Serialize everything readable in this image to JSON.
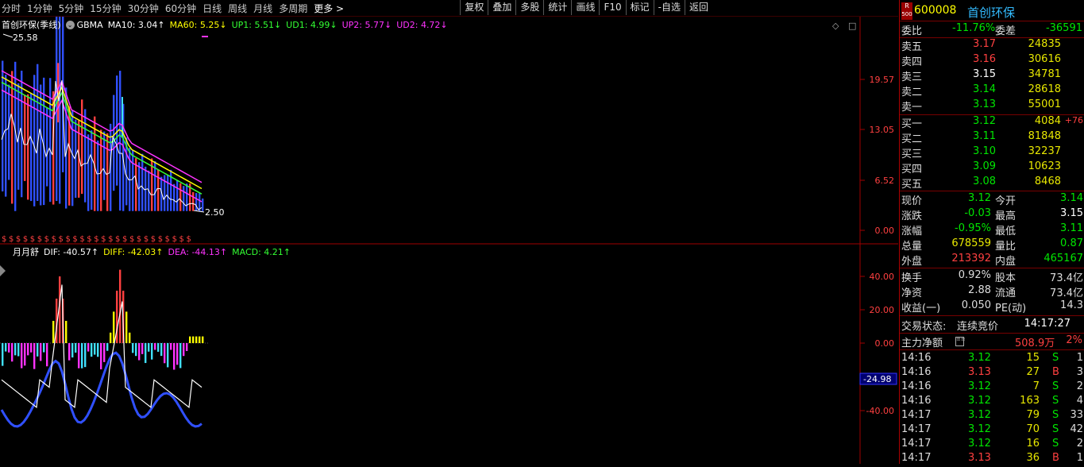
{
  "toolbar": {
    "periods": [
      "分时",
      "1分钟",
      "5分钟",
      "15分钟",
      "30分钟",
      "60分钟",
      "日线",
      "周线",
      "月线",
      "多周期"
    ],
    "more": "更多 >",
    "right_buttons": [
      "复权",
      "叠加",
      "多股",
      "统计",
      "画线",
      "F10",
      "标记",
      "-自选",
      "返回"
    ]
  },
  "main_chart": {
    "title": "首创环保(季线)",
    "indicator": "GBMA",
    "ma10": "MA10: 3.04↑",
    "ma60": "MA60: 5.25↓",
    "up1": "UP1: 5.51↓",
    "ud1": "UD1: 4.99↓",
    "up2": "UP2: 5.77↓",
    "ud2": "UD2: 4.72↓",
    "high_label": "25.58",
    "low_label": "2.50",
    "y_ticks": [
      "19.57",
      "13.05",
      "6.52",
      "0.00"
    ],
    "dollar_marks": "$ $ $ $ $ $ $ $ $ $ $ $ $ $ $ $ $ $ $ $ $ $ $ $ $ $ $"
  },
  "sub_chart": {
    "title": "月月舒",
    "dif": "DIF: -40.57↑",
    "diff": "DIFF: -42.03↑",
    "dea": "DEA: -44.13↑",
    "macd": "MACD: 4.21↑",
    "y_ticks": [
      "40.00",
      "20.00",
      "0.00",
      "-40.00"
    ],
    "current_value": "-24.98"
  },
  "quote": {
    "r_badge": "R",
    "r_sub": "500",
    "code": "600008",
    "name": "首创环保",
    "weibi_label": "委比",
    "weibi": "-11.76%",
    "weicha_label": "委差",
    "weicha": "-36591",
    "asks": [
      {
        "label": "卖五",
        "price": "3.17",
        "vol": "24835"
      },
      {
        "label": "卖四",
        "price": "3.16",
        "vol": "30616"
      },
      {
        "label": "卖三",
        "price": "3.15",
        "vol": "34781"
      },
      {
        "label": "卖二",
        "price": "3.14",
        "vol": "28618"
      },
      {
        "label": "卖一",
        "price": "3.13",
        "vol": "55001"
      }
    ],
    "bids": [
      {
        "label": "买一",
        "price": "3.12",
        "vol": "4084",
        "chg": "+76"
      },
      {
        "label": "买二",
        "price": "3.11",
        "vol": "81848",
        "chg": ""
      },
      {
        "label": "买三",
        "price": "3.10",
        "vol": "32237",
        "chg": ""
      },
      {
        "label": "买四",
        "price": "3.09",
        "vol": "10623",
        "chg": ""
      },
      {
        "label": "买五",
        "price": "3.08",
        "vol": "8468",
        "chg": ""
      }
    ],
    "stats": [
      {
        "l1": "现价",
        "v1": "3.12",
        "l2": "今开",
        "v2": "3.14"
      },
      {
        "l1": "涨跌",
        "v1": "-0.03",
        "l2": "最高",
        "v2": "3.15"
      },
      {
        "l1": "涨幅",
        "v1": "-0.95%",
        "l2": "最低",
        "v2": "3.11"
      },
      {
        "l1": "总量",
        "v1": "678559",
        "l2": "量比",
        "v2": "0.87"
      },
      {
        "l1": "外盘",
        "v1": "213392",
        "l2": "内盘",
        "v2": "465167"
      }
    ],
    "stats2": [
      {
        "l1": "换手",
        "v1": "0.92%",
        "l2": "股本",
        "v2": "73.4亿"
      },
      {
        "l1": "净资",
        "v1": "2.88",
        "l2": "流通",
        "v2": "73.4亿"
      },
      {
        "l1": "收益(一)",
        "v1": "0.050",
        "l2": "PE(动)",
        "v2": "14.3"
      }
    ],
    "trade_state_label": "交易状态:",
    "trade_state": "连续竞价",
    "trade_time": "14:17:27",
    "main_net_label": "主力净额",
    "main_net": "508.9万",
    "main_net_pct": "2%",
    "ticks": [
      {
        "time": "14:16",
        "price": "3.12",
        "vol": "15",
        "bs": "S",
        "n": "1"
      },
      {
        "time": "14:16",
        "price": "3.13",
        "vol": "27",
        "bs": "B",
        "n": "3"
      },
      {
        "time": "14:16",
        "price": "3.12",
        "vol": "7",
        "bs": "S",
        "n": "2"
      },
      {
        "time": "14:16",
        "price": "3.12",
        "vol": "163",
        "bs": "S",
        "n": "4"
      },
      {
        "time": "14:17",
        "price": "3.12",
        "vol": "79",
        "bs": "S",
        "n": "33"
      },
      {
        "time": "14:17",
        "price": "3.12",
        "vol": "70",
        "bs": "S",
        "n": "42"
      },
      {
        "time": "14:17",
        "price": "3.12",
        "vol": "16",
        "bs": "S",
        "n": "2"
      },
      {
        "time": "14:17",
        "price": "3.13",
        "vol": "36",
        "bs": "B",
        "n": "1"
      }
    ]
  },
  "colors": {
    "up": "#ff4040",
    "down": "#00e600",
    "axis": "#a00000",
    "ma_magenta": "#ff33ff",
    "ma_yellow": "#ffff00",
    "ma_green": "#33ff33",
    "ma_white": "#ffffff"
  }
}
